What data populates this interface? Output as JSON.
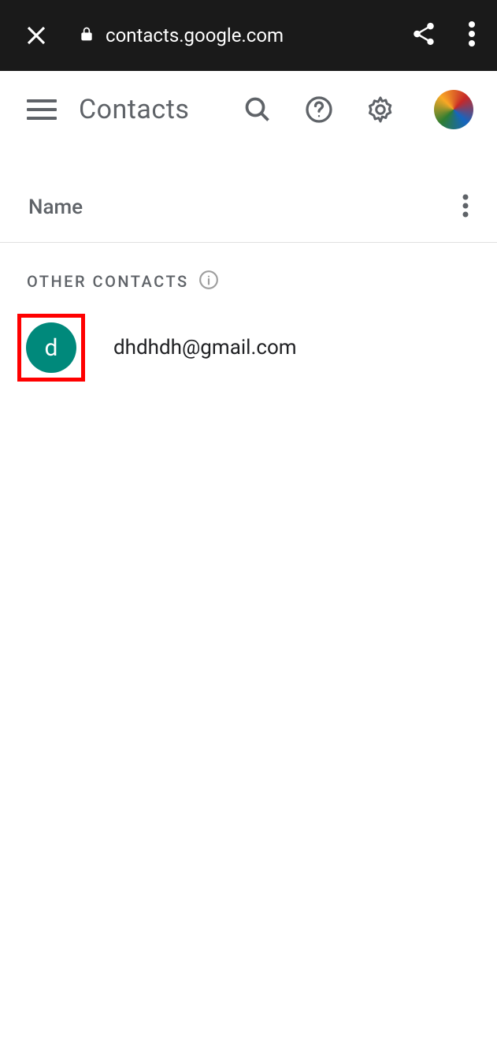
{
  "browser": {
    "url": "contacts.google.com"
  },
  "header": {
    "title": "Contacts"
  },
  "list_header": {
    "label": "Name"
  },
  "section": {
    "label": "OTHER CONTACTS"
  },
  "contacts": [
    {
      "initial": "d",
      "email": "dhdhdh@gmail.com",
      "avatar_color": "#00897b",
      "highlighted": true
    }
  ]
}
